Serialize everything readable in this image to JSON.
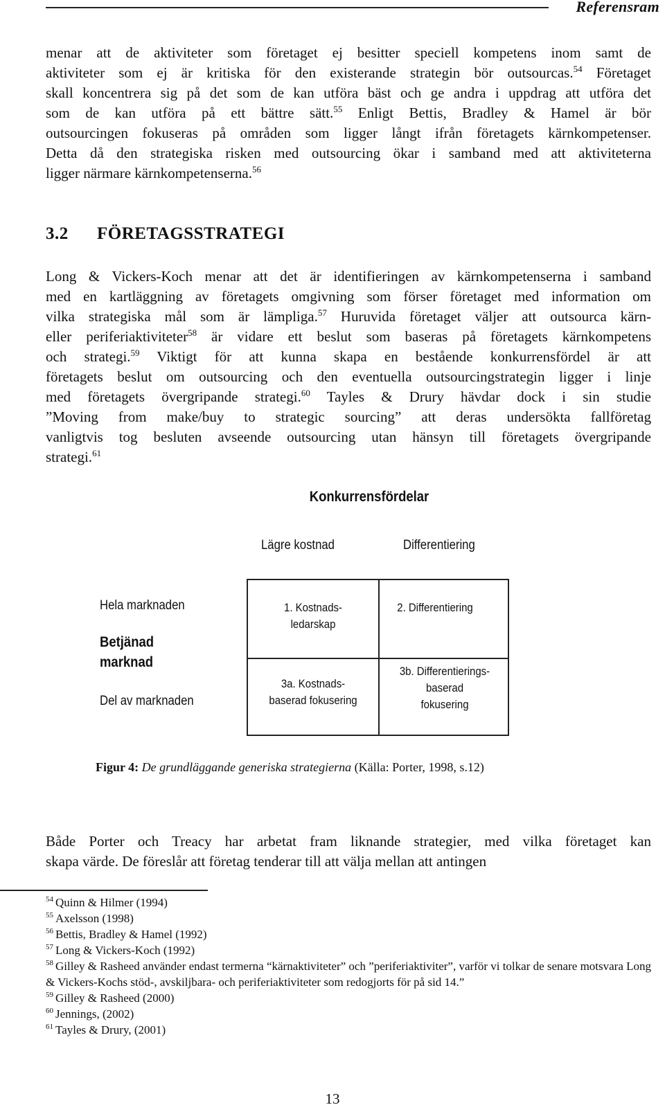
{
  "header": {
    "title": "Referensram"
  },
  "intro_paragraph": {
    "lines": [
      [
        {
          "t": "menar att de aktiviteter som företaget ej besitter speciell kompetens inom samt de"
        }
      ],
      [
        {
          "t": "aktiviteter som ej är kritiska för den existerande strategin bör outsourcas."
        },
        {
          "sup": "54"
        },
        {
          "t": " Företaget"
        }
      ],
      [
        {
          "t": "skall koncentrera sig på det som de kan utföra bäst och ge andra i uppdrag att utföra det"
        }
      ],
      [
        {
          "t": "som de kan utföra på ett bättre sätt."
        },
        {
          "sup": "55"
        },
        {
          "t": " Enligt Bettis, Bradley & Hamel är bör"
        }
      ],
      [
        {
          "t": "outsourcingen fokuseras på områden som ligger långt ifrån företagets kärnkompetenser."
        }
      ],
      [
        {
          "t": "Detta då den strategiska risken med outsourcing ökar i samband med att aktiviteterna"
        }
      ],
      [
        {
          "t": "ligger närmare kärnkompetenserna."
        },
        {
          "sup": "56"
        }
      ]
    ]
  },
  "section": {
    "number": "3.2",
    "title": "FÖRETAGSSTRATEGI"
  },
  "section_paragraph": {
    "lines": [
      [
        {
          "t": "Long & Vickers-Koch menar att det är identifieringen av kärnkompetenserna i samband"
        }
      ],
      [
        {
          "t": "med en kartläggning av företagets omgivning som förser företaget med information om"
        }
      ],
      [
        {
          "t": "vilka strategiska mål som är lämpliga."
        },
        {
          "sup": "57"
        },
        {
          "t": " Huruvida företaget väljer att outsourca kärn-"
        }
      ],
      [
        {
          "t": "eller periferiaktiviteter"
        },
        {
          "sup": "58"
        },
        {
          "t": " är vidare ett beslut som baseras på företagets kärnkompetens"
        }
      ],
      [
        {
          "t": "och strategi."
        },
        {
          "sup": "59"
        },
        {
          "t": " Viktigt för att kunna skapa en bestående konkurrensfördel är att"
        }
      ],
      [
        {
          "t": "företagets beslut om outsourcing och den eventuella outsourcingstrategin ligger i linje"
        }
      ],
      [
        {
          "t": "med företagets övergripande strategi."
        },
        {
          "sup": "60"
        },
        {
          "t": " Tayles & Drury hävdar dock i sin studie"
        }
      ],
      [
        {
          "t": "”Moving from make/buy to strategic sourcing” att deras undersökta fallföretag"
        }
      ],
      [
        {
          "t": "vanligtvis tog besluten avseende outsourcing utan hänsyn till företagets övergripande"
        }
      ],
      [
        {
          "t": "strategi."
        },
        {
          "sup": "61"
        }
      ]
    ]
  },
  "figure": {
    "title": "Konkurrensfördelar",
    "columns": [
      "Lägre kostnad",
      "Differentiering"
    ],
    "rows": {
      "top": "Hela marknaden",
      "middle": "Betjänad\nmarknad",
      "bottom": "Del av marknaden"
    },
    "cells": [
      "1. Kostnads-\nledarskap",
      "2. Differentiering",
      "3a. Kostnads-\nbaserad fokusering",
      "3b. Differentierings-\nbaserad\nfokusering"
    ],
    "caption": {
      "label": "Figur 4:",
      "title": "De grundläggande generiska strategierna",
      "source": "(Källa: Porter, 1998, s.12)"
    }
  },
  "closing_paragraph": {
    "lines": [
      [
        {
          "t": "Både Porter och Treacy har arbetat fram liknande strategier, med vilka företaget kan"
        }
      ],
      [
        {
          "t": "skapa värde. De föreslår att företag tenderar till att välja mellan att antingen"
        }
      ]
    ]
  },
  "footnotes": [
    {
      "num": "54",
      "text": "Quinn & Hilmer (1994)"
    },
    {
      "num": "55",
      "text": "Axelsson (1998)"
    },
    {
      "num": "56",
      "text": "Bettis, Bradley & Hamel (1992)"
    },
    {
      "num": "57",
      "text": "Long & Vickers-Koch (1992)"
    },
    {
      "num": "58",
      "text": "Gilley & Rasheed använder endast termerna “kärnaktiviteter” och ”periferiaktiviter”, varför vi tolkar de senare motsvara Long & Vickers-Kochs stöd-, avskiljbara- och periferiaktiviteter som redogjorts för på sid 14.”"
    },
    {
      "num": "59",
      "text": "Gilley & Rasheed (2000)"
    },
    {
      "num": "60",
      "text": "Jennings, (2002)"
    },
    {
      "num": "61",
      "text": "Tayles & Drury, (2001)"
    }
  ],
  "page_number": "13"
}
